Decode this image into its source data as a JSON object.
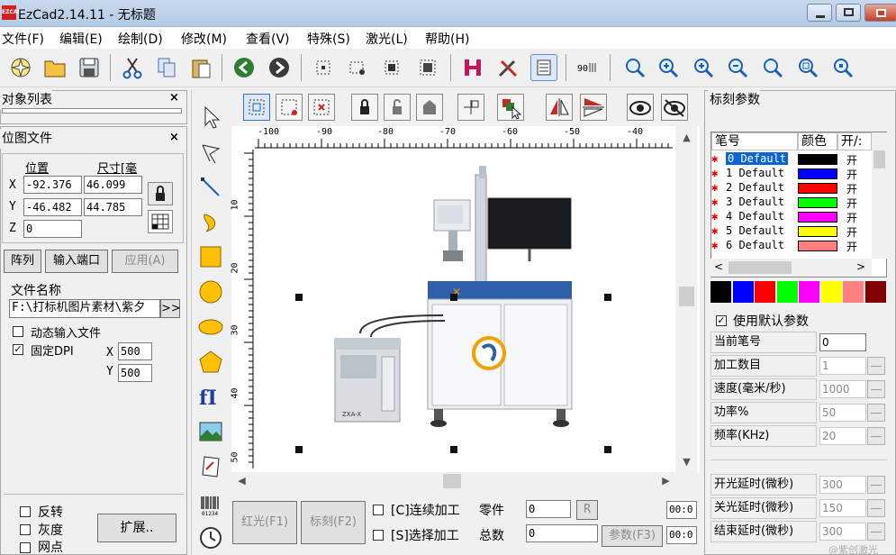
{
  "window": {
    "app_icon": "EZCAD",
    "title": "EzCad2.14.11 - 无标题"
  },
  "menu": [
    "文件(F)",
    "编辑(E)",
    "绘制(D)",
    "修改(M)",
    "查看(V)",
    "特殊(S)",
    "激光(L)",
    "帮助(H)"
  ],
  "object_list": {
    "title": "对象列表",
    "close": "×"
  },
  "bitmap": {
    "title": "位图文件",
    "close": "×",
    "pos_label": "位置",
    "size_label": "尺寸[毫",
    "x_label": "X",
    "y_label": "Y",
    "z_label": "Z",
    "x": "-92.376",
    "y": "-46.482",
    "z": "0",
    "w": "46.099",
    "h": "44.785",
    "array_button": "阵列",
    "input_port_button": "输入端口",
    "apply_button": "应用(A)",
    "filename_label": "文件名称",
    "filename": "F:\\打标机图片素材\\紫夕",
    "browse_button": ">>",
    "dynamic_label": "动态输入文件",
    "fixed_dpi_label": "固定DPI",
    "dpi_x_label": "X",
    "dpi_y_label": "Y",
    "dpi_x": "500",
    "dpi_y": "500",
    "invert_label": "反转",
    "gray_label": "灰度",
    "dither_label": "网点",
    "expand_button": "扩展.."
  },
  "ruler": {
    "h_ticks": [
      "-100",
      "-90",
      "-80",
      "-70",
      "-60",
      "-50",
      "-40"
    ],
    "v_ticks": [
      "10",
      "20",
      "30",
      "40",
      "50"
    ]
  },
  "bottom": {
    "red_button": "红光(F1)",
    "mark_button": "标刻(F2)",
    "continuous_label": "[C]连续加工",
    "select_label": "[S]选择加工",
    "parts_label": "零件",
    "total_label": "总数",
    "parts_value": "0",
    "total_value": "0",
    "reset_button": "R",
    "params_button": "参数(F3)",
    "time1": "00:0",
    "time2": "00:0"
  },
  "mark_params": {
    "title": "标刻参数",
    "pen_header": "笔号",
    "color_header": "颜色",
    "onoff_header": "开/:",
    "pens": [
      {
        "label": "0 Default",
        "color": "#000000",
        "state": "开"
      },
      {
        "label": "1 Default",
        "color": "#0000ff",
        "state": "开"
      },
      {
        "label": "2 Default",
        "color": "#ff0000",
        "state": "开"
      },
      {
        "label": "3 Default",
        "color": "#00ff00",
        "state": "开"
      },
      {
        "label": "4 Default",
        "color": "#ff00ff",
        "state": "开"
      },
      {
        "label": "5 Default",
        "color": "#ffff00",
        "state": "开"
      },
      {
        "label": "6 Default",
        "color": "#ff7f7f",
        "state": "开"
      }
    ],
    "palette": [
      "#000000",
      "#0000ff",
      "#ff0000",
      "#00ff00",
      "#ff00ff",
      "#ffff00",
      "#ff8080",
      "#800000"
    ],
    "use_default_label": "使用默认参数",
    "fields": [
      {
        "label": "当前笔号",
        "value": "0",
        "active": true,
        "spin": false
      },
      {
        "label": "加工数目",
        "value": "1",
        "active": false,
        "spin": true
      },
      {
        "label": "速度(毫米/秒)",
        "value": "1000",
        "active": false,
        "spin": true
      },
      {
        "label": "功率%",
        "value": "50",
        "active": false,
        "spin": true
      },
      {
        "label": "频率(KHz)",
        "value": "20",
        "active": false,
        "spin": true
      }
    ],
    "delays": [
      {
        "label": "开光延时(微秒)",
        "value": "300"
      },
      {
        "label": "关光延时(微秒)",
        "value": "150"
      },
      {
        "label": "结束延时(微秒)",
        "value": "300"
      }
    ],
    "watermark": "@紫创激光"
  }
}
